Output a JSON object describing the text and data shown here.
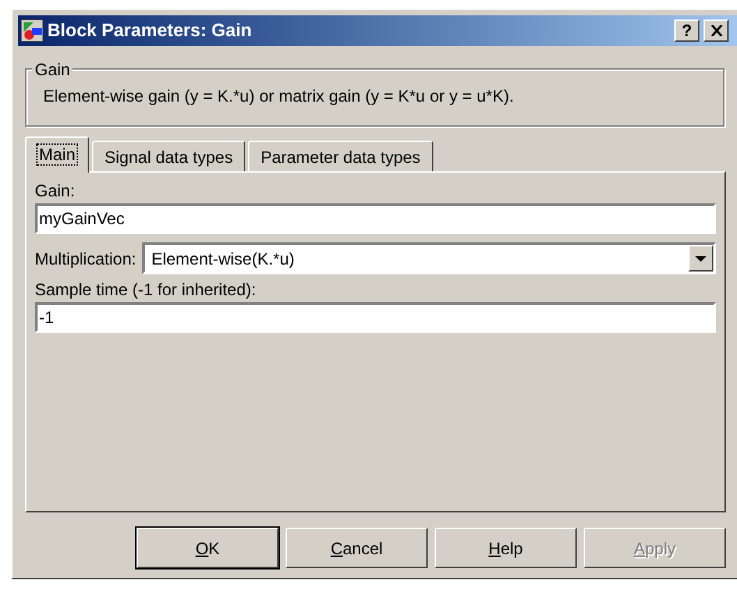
{
  "window": {
    "title": "Block Parameters: Gain",
    "help_button": "?"
  },
  "description": {
    "group_title": "Gain",
    "text": "Element-wise gain (y = K.*u) or matrix gain (y = K*u or y = u*K)."
  },
  "tabs": [
    {
      "label": "Main",
      "selected": true
    },
    {
      "label": "Signal data types",
      "selected": false
    },
    {
      "label": "Parameter data types",
      "selected": false
    }
  ],
  "fields": [
    {
      "kind": "text",
      "label": "Gain:",
      "value": "myGainVec"
    },
    {
      "kind": "dropdown",
      "label": "Multiplication:",
      "value": "Element-wise(K.*u)"
    },
    {
      "kind": "text",
      "label": "Sample time (-1 for inherited):",
      "value": "-1"
    }
  ],
  "buttons": [
    {
      "label": "OK",
      "disabled": false,
      "default": true
    },
    {
      "label": "Cancel",
      "disabled": false,
      "default": false
    },
    {
      "label": "Help",
      "disabled": false,
      "default": false
    },
    {
      "label": "Apply",
      "disabled": true,
      "default": false
    }
  ]
}
